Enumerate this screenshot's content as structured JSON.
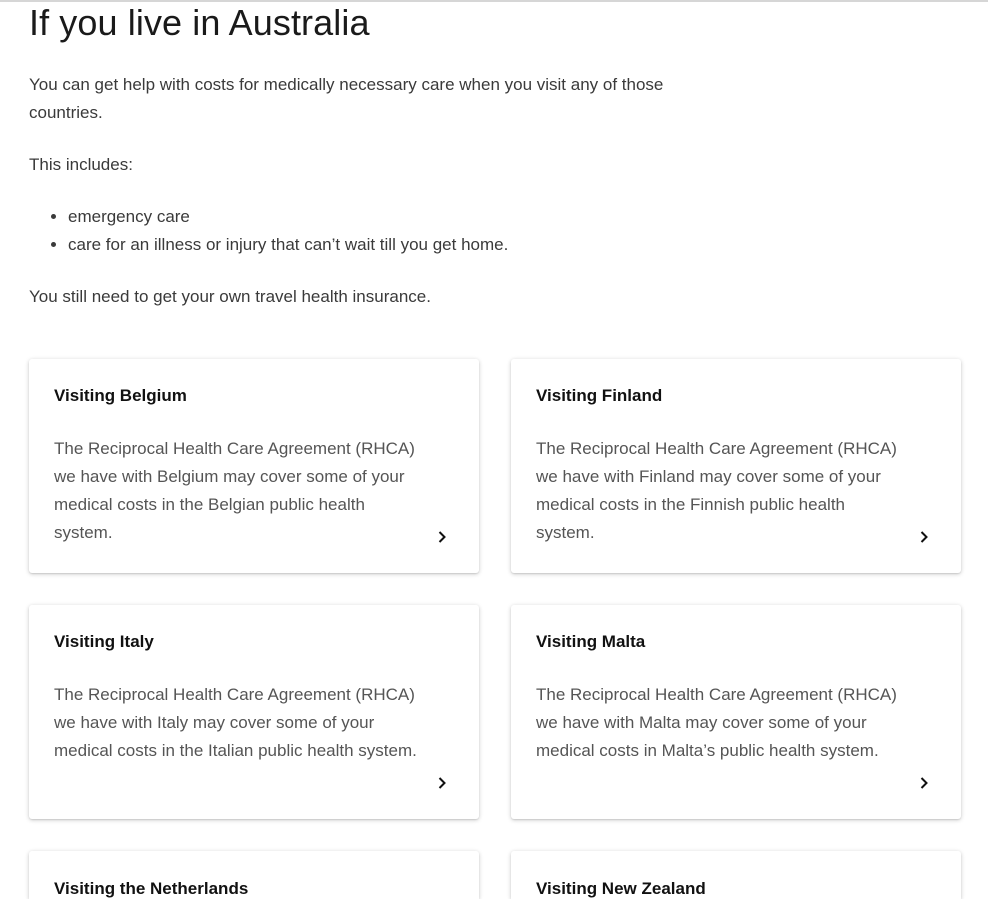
{
  "heading": "If you live in Australia",
  "intro": "You can get help with costs for medically necessary care when you visit any of those countries.",
  "includes_label": "This includes:",
  "bullets": [
    "emergency care",
    "care for an illness or injury that can’t wait till you get home."
  ],
  "insurance_note": "You still need to get your own travel health insurance.",
  "cards": [
    {
      "title": "Visiting Belgium",
      "text": "The Reciprocal Health Care Agreement (RHCA) we have with Belgium may cover some of your medical costs in the Belgian public health system.",
      "icon": "chevron-right-icon"
    },
    {
      "title": "Visiting Finland",
      "text": "The Reciprocal Health Care Agreement (RHCA) we have with Finland may cover some of your medical costs in the Finnish public health system.",
      "icon": "chevron-right-icon"
    },
    {
      "title": "Visiting Italy",
      "text": "The Reciprocal Health Care Agreement (RHCA) we have with Italy may cover some of your medical costs in the Italian public health system.",
      "icon": "chevron-right-icon"
    },
    {
      "title": "Visiting Malta",
      "text": "The Reciprocal Health Care Agreement (RHCA) we have with Malta may cover some of your medical costs in Malta’s public health system.",
      "icon": "chevron-right-icon"
    },
    {
      "title": "Visiting the Netherlands"
    },
    {
      "title": "Visiting New Zealand"
    }
  ],
  "colors": {
    "heading": "#1a1a1a",
    "body_text": "#3a3a3a",
    "card_text": "#555555",
    "card_title": "#111111"
  }
}
